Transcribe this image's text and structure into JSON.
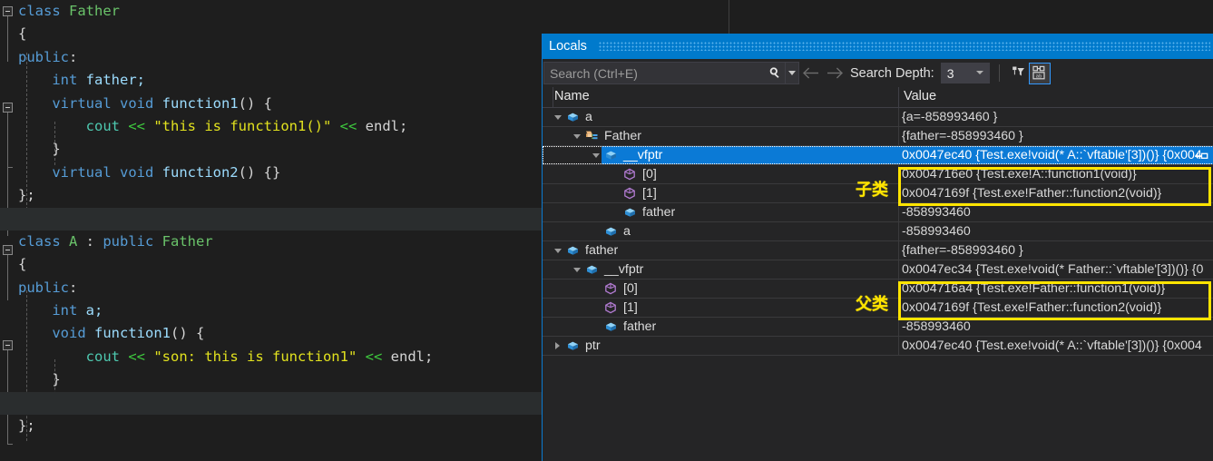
{
  "editor": {
    "code_lines": [
      [
        {
          "t": "class ",
          "c": "kw"
        },
        {
          "t": "Father",
          "c": "cls"
        }
      ],
      [
        {
          "t": "{",
          "c": "punc"
        }
      ],
      [
        {
          "t": "public",
          "c": "kw"
        },
        {
          "t": ":",
          "c": "punc"
        }
      ],
      [
        {
          "t": "    ",
          "c": "punc"
        },
        {
          "t": "int ",
          "c": "kw"
        },
        {
          "t": "father;",
          "c": "id"
        }
      ],
      [
        {
          "t": "    ",
          "c": "punc"
        },
        {
          "t": "virtual ",
          "c": "kw"
        },
        {
          "t": "void ",
          "c": "kw"
        },
        {
          "t": "function1",
          "c": "id"
        },
        {
          "t": "() {",
          "c": "punc"
        }
      ],
      [
        {
          "t": "        ",
          "c": "punc"
        },
        {
          "t": "cout",
          "c": "cout"
        },
        {
          "t": " ",
          "c": "punc"
        },
        {
          "t": "<<",
          "c": "op"
        },
        {
          "t": " ",
          "c": "punc"
        },
        {
          "t": "\"this is function1()\"",
          "c": "str"
        },
        {
          "t": " ",
          "c": "punc"
        },
        {
          "t": "<<",
          "c": "op"
        },
        {
          "t": " endl;",
          "c": "punc"
        }
      ],
      [
        {
          "t": "    }",
          "c": "punc"
        }
      ],
      [
        {
          "t": "    ",
          "c": "punc"
        },
        {
          "t": "virtual ",
          "c": "kw"
        },
        {
          "t": "void ",
          "c": "kw"
        },
        {
          "t": "function2",
          "c": "id"
        },
        {
          "t": "() {}",
          "c": "punc"
        }
      ],
      [
        {
          "t": "};",
          "c": "punc"
        }
      ],
      [],
      [
        {
          "t": "class ",
          "c": "kw"
        },
        {
          "t": "A",
          "c": "cls"
        },
        {
          "t": " : ",
          "c": "punc"
        },
        {
          "t": "public ",
          "c": "kw"
        },
        {
          "t": "Father",
          "c": "cls"
        }
      ],
      [
        {
          "t": "{",
          "c": "punc"
        }
      ],
      [
        {
          "t": "public",
          "c": "kw"
        },
        {
          "t": ":",
          "c": "punc"
        }
      ],
      [
        {
          "t": "    ",
          "c": "punc"
        },
        {
          "t": "int ",
          "c": "kw"
        },
        {
          "t": "a;",
          "c": "id"
        }
      ],
      [
        {
          "t": "    ",
          "c": "punc"
        },
        {
          "t": "void ",
          "c": "kw"
        },
        {
          "t": "function1",
          "c": "id"
        },
        {
          "t": "() {",
          "c": "punc"
        }
      ],
      [
        {
          "t": "        ",
          "c": "punc"
        },
        {
          "t": "cout",
          "c": "cout"
        },
        {
          "t": " ",
          "c": "punc"
        },
        {
          "t": "<<",
          "c": "op"
        },
        {
          "t": " ",
          "c": "punc"
        },
        {
          "t": "\"son: this is function1\"",
          "c": "str"
        },
        {
          "t": " ",
          "c": "punc"
        },
        {
          "t": "<<",
          "c": "op"
        },
        {
          "t": " endl;",
          "c": "punc"
        }
      ],
      [
        {
          "t": "    }",
          "c": "punc"
        }
      ],
      [],
      [
        {
          "t": "};",
          "c": "punc"
        }
      ]
    ]
  },
  "locals": {
    "title": "Locals",
    "search": {
      "placeholder": "Search (Ctrl+E)",
      "value": "",
      "icon": "search-icon",
      "dropdown_icon": "chevron-down-icon"
    },
    "nav_back_icon": "arrow-left-icon",
    "nav_forward_icon": "arrow-right-icon",
    "search_depth_label": "Search Depth:",
    "search_depth_value": "3",
    "toolbar_buttons": [
      {
        "name": "pin-filter-icon",
        "label": ""
      },
      {
        "name": "hex-display-icon",
        "label": ""
      }
    ],
    "columns": [
      "Name",
      "Value"
    ],
    "rows": [
      {
        "name": "a",
        "value": "{a=-858993460 }",
        "indent": 0,
        "expander": "down",
        "icon": "field-cube-icon",
        "selected": false
      },
      {
        "name": "Father",
        "value": "{father=-858993460 }",
        "indent": 1,
        "expander": "down",
        "icon": "base-class-icon",
        "selected": false
      },
      {
        "name": "__vfptr",
        "value": "0x0047ec40 {Test.exe!void(* A::`vftable'[3])()} {0x004",
        "indent": 2,
        "expander": "down",
        "icon": "field-cube-icon",
        "selected": true
      },
      {
        "name": "[0]",
        "value": "0x004716e0 {Test.exe!A::function1(void)}",
        "indent": 3,
        "expander": "none",
        "icon": "pointer-cube-icon",
        "selected": false
      },
      {
        "name": "[1]",
        "value": "0x0047169f {Test.exe!Father::function2(void)}",
        "indent": 3,
        "expander": "none",
        "icon": "pointer-cube-icon",
        "selected": false
      },
      {
        "name": "father",
        "value": "-858993460",
        "indent": 3,
        "expander": "none",
        "icon": "field-cube-icon",
        "selected": false
      },
      {
        "name": "a",
        "value": "-858993460",
        "indent": 2,
        "expander": "none",
        "icon": "field-cube-icon",
        "selected": false
      },
      {
        "name": "father",
        "value": "{father=-858993460 }",
        "indent": 0,
        "expander": "down",
        "icon": "field-cube-icon",
        "selected": false
      },
      {
        "name": "__vfptr",
        "value": "0x0047ec34 {Test.exe!void(* Father::`vftable'[3])()} {0",
        "indent": 1,
        "expander": "down",
        "icon": "field-cube-icon",
        "selected": false
      },
      {
        "name": "[0]",
        "value": "0x004716a4 {Test.exe!Father::function1(void)}",
        "indent": 2,
        "expander": "none",
        "icon": "pointer-cube-icon",
        "selected": false
      },
      {
        "name": "[1]",
        "value": "0x0047169f {Test.exe!Father::function2(void)}",
        "indent": 2,
        "expander": "none",
        "icon": "pointer-cube-icon",
        "selected": false
      },
      {
        "name": "father",
        "value": "-858993460",
        "indent": 2,
        "expander": "none",
        "icon": "field-cube-icon",
        "selected": false
      },
      {
        "name": "ptr",
        "value": "0x0047ec40 {Test.exe!void(* A::`vftable'[3])()} {0x004",
        "indent": 0,
        "expander": "right",
        "icon": "field-cube-icon",
        "selected": false
      }
    ]
  },
  "annotations": [
    {
      "text": "子类",
      "name": "annotation-subclass"
    },
    {
      "text": "父类",
      "name": "annotation-superclass"
    }
  ],
  "colors": {
    "accent": "#007acc",
    "selection": "#0b7ad6",
    "annotation": "#ffe400",
    "panel_bg": "#252526",
    "editor_bg": "#1e1e1e"
  }
}
